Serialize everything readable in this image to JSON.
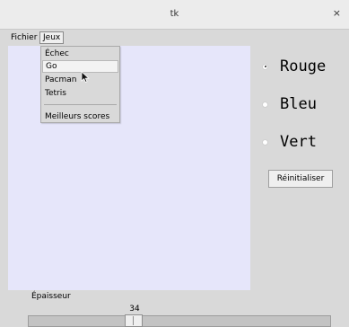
{
  "window": {
    "title": "tk",
    "close_symbol": "×"
  },
  "menubar": {
    "items": [
      "Fichier",
      "Jeux"
    ],
    "open_menu": "Jeux"
  },
  "dropdown": {
    "items": [
      "Échec",
      "Go",
      "Pacman",
      "Tetris",
      "Meilleurs scores"
    ],
    "highlighted": "Go"
  },
  "canvas": {
    "background": "#e6e6fa"
  },
  "colors": {
    "options": [
      "Rouge",
      "Bleu",
      "Vert"
    ],
    "selected": "Rouge"
  },
  "reset_label": "Réinitialiser",
  "thickness": {
    "label": "Épaisseur",
    "value": "34"
  }
}
